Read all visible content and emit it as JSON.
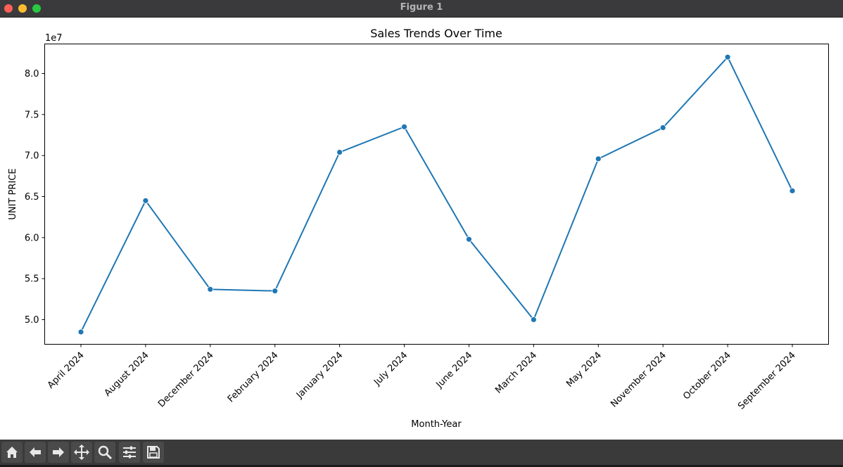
{
  "window": {
    "title": "Figure 1"
  },
  "toolbar": {
    "buttons": [
      {
        "icon": "home-icon"
      },
      {
        "icon": "back-arrow-icon"
      },
      {
        "icon": "forward-arrow-icon"
      },
      {
        "icon": "pan-icon"
      },
      {
        "icon": "zoom-icon"
      },
      {
        "icon": "configure-subplots-icon"
      },
      {
        "icon": "save-icon"
      }
    ]
  },
  "chart_data": {
    "type": "line",
    "title": "Sales Trends Over Time",
    "xlabel": "Month-Year",
    "ylabel": "UNIT PRICE",
    "offset_label": "1e7",
    "categories": [
      "April 2024",
      "August 2024",
      "December 2024",
      "February 2024",
      "January 2024",
      "July 2024",
      "June 2024",
      "March 2024",
      "May 2024",
      "November 2024",
      "October 2024",
      "September 2024"
    ],
    "series": [
      {
        "values": [
          4.85,
          6.45,
          5.37,
          5.35,
          7.04,
          7.35,
          5.98,
          5.0,
          6.96,
          7.34,
          8.2,
          6.57
        ],
        "color": "#1f77b4"
      }
    ],
    "yticks": [
      5.0,
      5.5,
      6.0,
      6.5,
      7.0,
      7.5,
      8.0
    ],
    "ytick_labels": [
      "5.0",
      "5.5",
      "6.0",
      "6.5",
      "7.0",
      "7.5",
      "8.0"
    ],
    "ylim": [
      4.7,
      8.36
    ],
    "grid": false,
    "legend": false
  }
}
